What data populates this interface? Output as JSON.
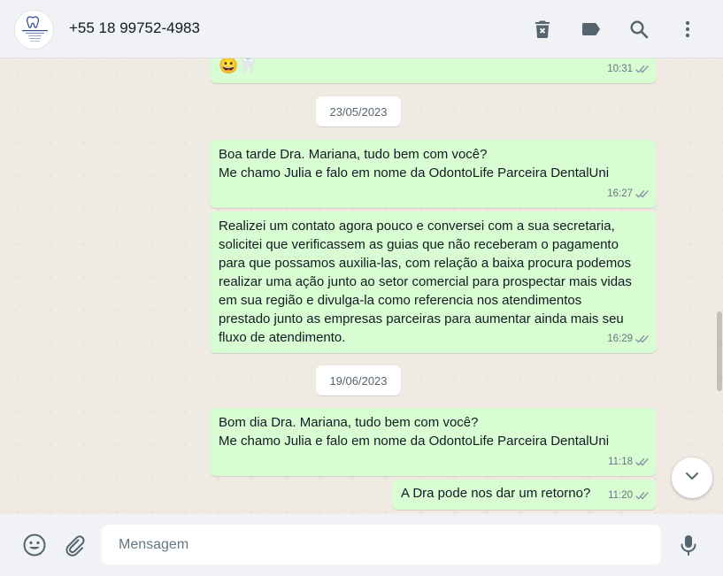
{
  "header": {
    "contact_name": "+55 18 99752-4983",
    "icons": [
      "delete-icon",
      "label-icon",
      "search-icon",
      "menu-icon"
    ]
  },
  "messages": [
    {
      "text": "😀🦷",
      "time": "10:31"
    },
    {
      "date": "23/05/2023"
    },
    {
      "text": "Boa tarde Dra. Mariana, tudo bem com você?\nMe chamo Julia e falo em nome da OdontoLife Parceira DentalUni",
      "time": "16:27"
    },
    {
      "text": "Realizei um contato agora pouco e conversei com a sua secretaria,\nsolicitei que verificassem as guias que não receberam o pagamento\npara que possamos auxilia-las, com relação a baixa procura podemos\nrealizar uma ação junto ao setor comercial para prospectar mais vidas\nem sua região e divulga-la como referencia nos atendimentos\nprestado junto as empresas parceiras para aumentar ainda mais seu\nfluxo de atendimento.",
      "time": "16:29"
    },
    {
      "date": "19/06/2023"
    },
    {
      "text": "Bom dia Dra. Mariana, tudo bem com você?\nMe chamo Julia e falo em nome da OdontoLife Parceira DentalUni",
      "time": "11:18"
    },
    {
      "text": "A Dra pode nos dar um retorno?",
      "time": "11:20"
    }
  ],
  "composer": {
    "placeholder": "Mensagem"
  },
  "colors": {
    "outgoing_bubble": "#d9fdd3",
    "read_tick": "#8696a0",
    "header_bg": "#f0f2f5",
    "chat_bg": "#efeae2"
  }
}
